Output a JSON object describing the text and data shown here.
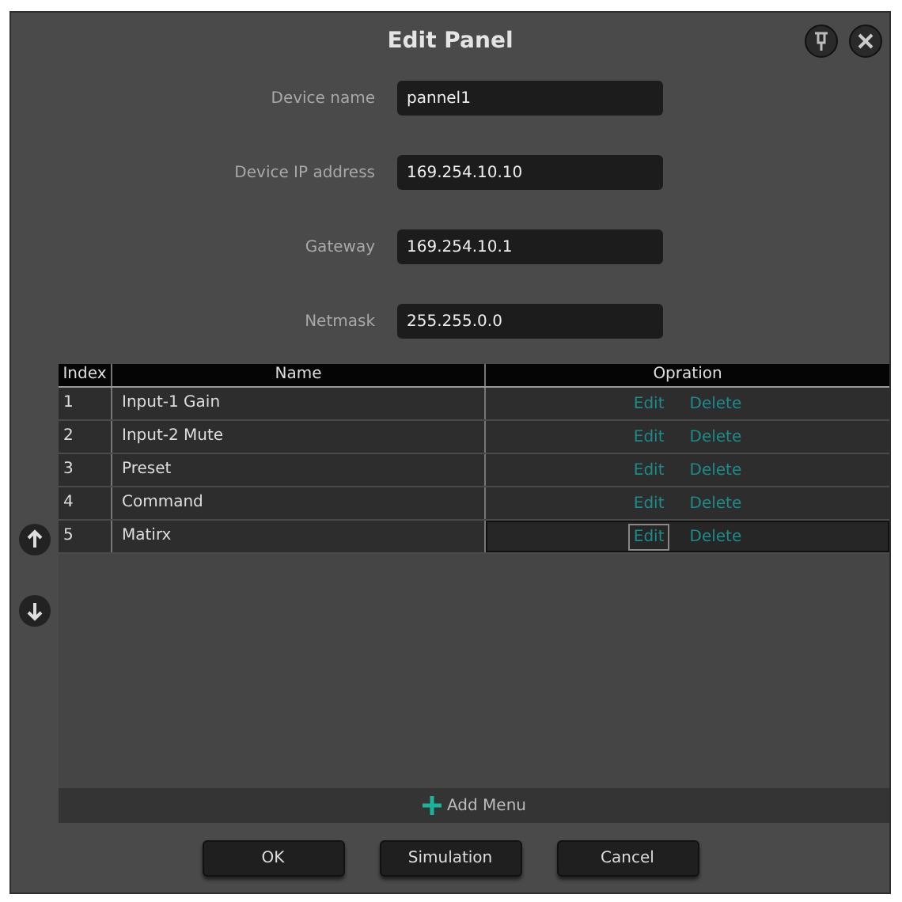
{
  "window": {
    "title": "Edit Panel"
  },
  "fields": [
    {
      "label": "Device name",
      "value": "pannel1"
    },
    {
      "label": "Device IP address",
      "value": "169.254.10.10"
    },
    {
      "label": "Gateway",
      "value": "169.254.10.1"
    },
    {
      "label": "Netmask",
      "value": "255.255.0.0"
    }
  ],
  "table": {
    "columns": [
      "Index",
      "Name",
      "Opration"
    ],
    "rows": [
      {
        "index": "1",
        "name": "Input-1 Gain",
        "edit": "Edit",
        "delete": "Delete",
        "selected": false
      },
      {
        "index": "2",
        "name": "Input-2 Mute",
        "edit": "Edit",
        "delete": "Delete",
        "selected": false
      },
      {
        "index": "3",
        "name": "Preset",
        "edit": "Edit",
        "delete": "Delete",
        "selected": false
      },
      {
        "index": "4",
        "name": "Command",
        "edit": "Edit",
        "delete": "Delete",
        "selected": false
      },
      {
        "index": "5",
        "name": "Matirx",
        "edit": "Edit",
        "delete": "Delete",
        "selected": true
      }
    ]
  },
  "add_button": "Add Menu",
  "buttons": [
    "OK",
    "Simulation",
    "Cancel"
  ]
}
